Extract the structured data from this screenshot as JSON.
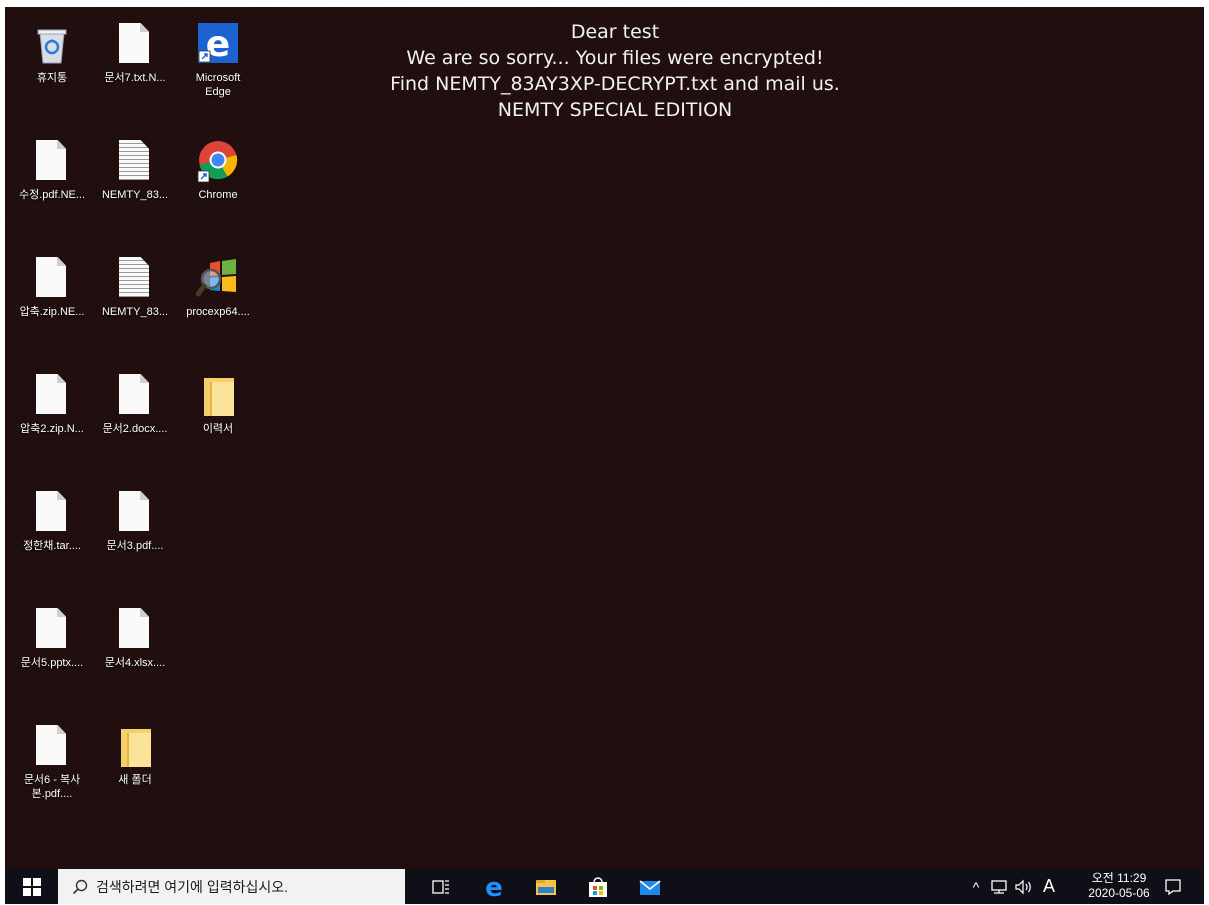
{
  "ransom_note": {
    "line1": "Dear test",
    "line2": "We are so sorry... Your files were encrypted!",
    "line3": "Find NEMTY_83AY3XP-DECRYPT.txt and mail us.",
    "line4": "NEMTY SPECIAL EDITION"
  },
  "desktop_icons": [
    {
      "label": "휴지통",
      "icon": "recycle-bin-icon"
    },
    {
      "label": "문서7.txt.N...",
      "icon": "document-icon"
    },
    {
      "label": "Microsoft Edge",
      "icon": "edge-icon"
    },
    {
      "label": "수정.pdf.NE...",
      "icon": "document-icon"
    },
    {
      "label": "NEMTY_83...",
      "icon": "text-file-icon"
    },
    {
      "label": "Chrome",
      "icon": "chrome-icon"
    },
    {
      "label": "압축.zip.NE...",
      "icon": "document-icon"
    },
    {
      "label": "NEMTY_83...",
      "icon": "text-file-icon"
    },
    {
      "label": "procexp64....",
      "icon": "process-explorer-icon"
    },
    {
      "label": "압축2.zip.N...",
      "icon": "document-icon"
    },
    {
      "label": "문서2.docx....",
      "icon": "document-icon"
    },
    {
      "label": "이력서",
      "icon": "folder-icon"
    },
    {
      "label": "정한채.tar....",
      "icon": "document-icon"
    },
    {
      "label": "문서3.pdf....",
      "icon": "document-icon"
    },
    {
      "label": "문서5.pptx....",
      "icon": "document-icon"
    },
    {
      "label": "문서4.xlsx....",
      "icon": "document-icon"
    },
    {
      "label": "문서6 - 복사본.pdf....",
      "icon": "document-icon"
    },
    {
      "label": "새 폴더",
      "icon": "folder-icon"
    }
  ],
  "taskbar": {
    "search_placeholder": "검색하려면 여기에 입력하십시오.",
    "tray_chevron": "^",
    "ime_indicator": "A",
    "clock_time": "오전 11:29",
    "clock_date": "2020-05-06"
  },
  "colors": {
    "desktop_bg": "#1e0c0c",
    "taskbar_bg": "#0f1017",
    "edge_blue": "#1d62d1",
    "folder_yellow": "#f4cf6a"
  }
}
